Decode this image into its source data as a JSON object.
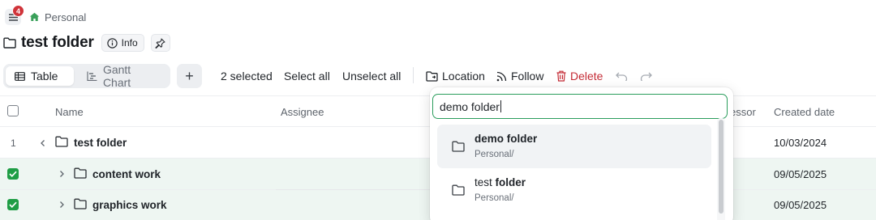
{
  "nav": {
    "notification_count": "4",
    "breadcrumb": "Personal"
  },
  "page": {
    "title": "test folder",
    "info_label": "Info"
  },
  "toolbar": {
    "views": [
      {
        "label": "Table",
        "active": true
      },
      {
        "label": "Gantt Chart",
        "active": false
      }
    ],
    "add_label": "+",
    "selected_count": "2 selected",
    "select_all": "Select all",
    "unselect_all": "Unselect all",
    "location": "Location",
    "follow": "Follow",
    "delete": "Delete",
    "delete_color": "#c42b35"
  },
  "table": {
    "columns": {
      "name": "Name",
      "assignee": "Assignee",
      "predecessor": "essor",
      "created_date": "Created date"
    },
    "rows": [
      {
        "number": "1",
        "name": "test folder",
        "created": "10/03/2024",
        "selected": false,
        "expanded": true
      },
      {
        "number": "",
        "name": "content work",
        "created": "09/05/2025",
        "selected": true,
        "expanded": false
      },
      {
        "number": "",
        "name": "graphics work",
        "created": "09/05/2025",
        "selected": true,
        "expanded": false
      }
    ]
  },
  "location_dropdown": {
    "query": "demo folder",
    "options": [
      {
        "title": "demo folder",
        "bold_part": "demo folder",
        "path": "Personal/",
        "highlighted": true
      },
      {
        "title_plain": "test ",
        "title_bold": "folder",
        "path": "Personal/",
        "highlighted": false
      }
    ]
  },
  "colors": {
    "accent_green": "#1f9d45",
    "input_focus": "#2a9d5c",
    "badge_red": "#d0343a",
    "selected_row_bg": "#eef6f2"
  }
}
